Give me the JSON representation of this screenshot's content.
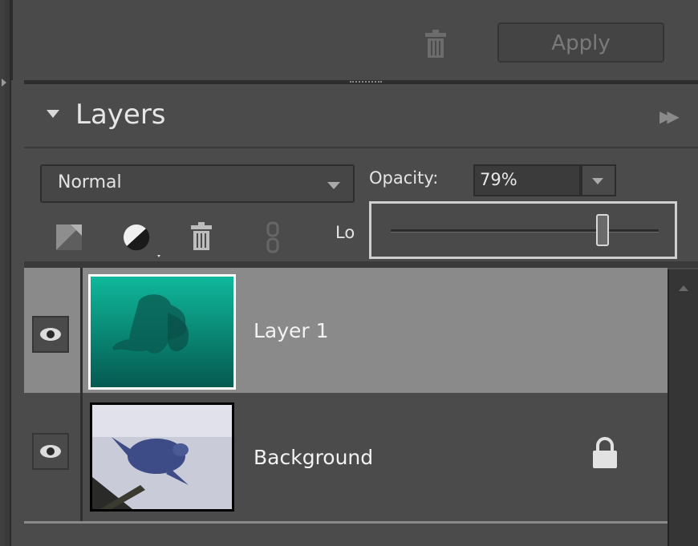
{
  "toolbar": {
    "apply_label": "Apply"
  },
  "panel": {
    "title": "Layers",
    "blend_mode": "Normal",
    "opacity_label": "Opacity:",
    "opacity_value": "79%",
    "opacity_slider_fraction": 0.79,
    "lock_label": "Lo"
  },
  "layers": [
    {
      "name": "Layer 1",
      "selected": true,
      "visible": true,
      "locked": false
    },
    {
      "name": "Background",
      "selected": false,
      "visible": true,
      "locked": true
    }
  ],
  "icons": {
    "trash": "trash-icon",
    "eye": "eye-icon",
    "lock": "lock-icon",
    "new_layer": "new-layer-icon",
    "adjustment": "adjustment-layer-icon",
    "link": "link-icon"
  },
  "colors": {
    "panel_bg": "#4b4b4b",
    "selected_row": "#8a8a8a",
    "accent_teal": "#0fa58c"
  }
}
